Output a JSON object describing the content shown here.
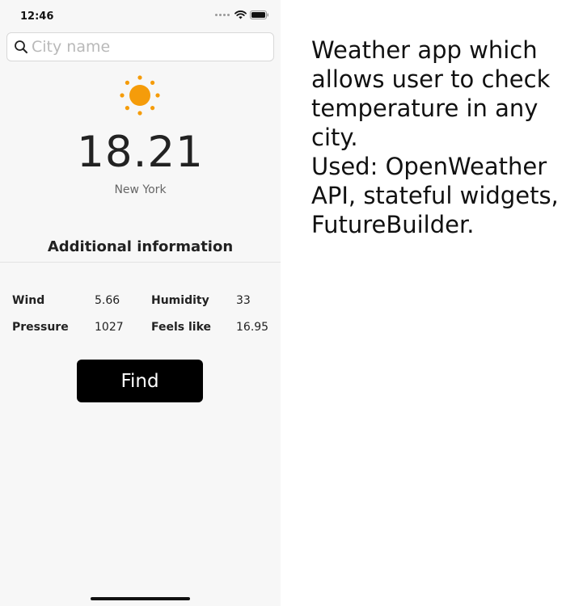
{
  "status_bar": {
    "time": "12:46",
    "icons": [
      "signal-icon",
      "wifi-icon",
      "battery-icon"
    ]
  },
  "search": {
    "placeholder": "City name",
    "value": "",
    "icon": "search-icon"
  },
  "weather": {
    "icon": "sun-icon",
    "icon_color": "#f5a623",
    "temperature": "18.21",
    "city": "New York"
  },
  "additional_info": {
    "title": "Additional information",
    "wind_label": "Wind",
    "wind_value": "5.66",
    "humidity_label": "Humidity",
    "humidity_value": "33",
    "pressure_label": "Pressure",
    "pressure_value": "1027",
    "feels_like_label": "Feels like",
    "feels_like_value": "16.95"
  },
  "find_button": {
    "label": "Find",
    "color": "#000000"
  },
  "description": {
    "line1": "Weather app which",
    "line2": "allows user to check",
    "line3": "temperature in any",
    "line4": "city.",
    "line5": "Used: OpenWeather",
    "line6": "API, stateful widgets,",
    "line7": "FutureBuilder."
  }
}
